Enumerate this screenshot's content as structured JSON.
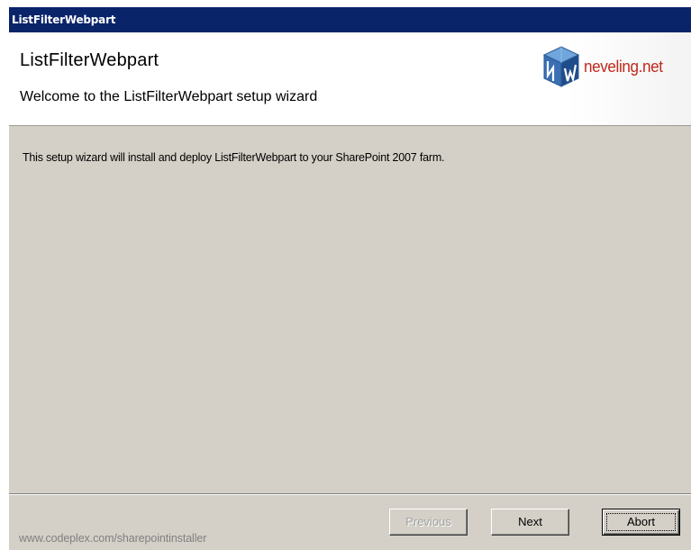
{
  "window": {
    "title": "ListFilterWebpart"
  },
  "banner": {
    "title": "ListFilterWebpart",
    "subtitle": "Welcome to the ListFilterWebpart setup wizard",
    "logo_text": "neveling.net"
  },
  "content": {
    "message": "This setup wizard will install and deploy ListFilterWebpart to your SharePoint 2007 farm."
  },
  "footer": {
    "link_text": "www.codeplex.com/sharepointinstaller",
    "buttons": {
      "previous": "Previous",
      "next": "Next",
      "abort": "Abort"
    }
  },
  "colors": {
    "titlebar": "#0a246a",
    "dialog_face": "#d4d0c8",
    "logo_text": "#c0281a",
    "logo_cube": "#3a6fb5"
  },
  "icons": {
    "logo": "cube-logo-icon"
  }
}
